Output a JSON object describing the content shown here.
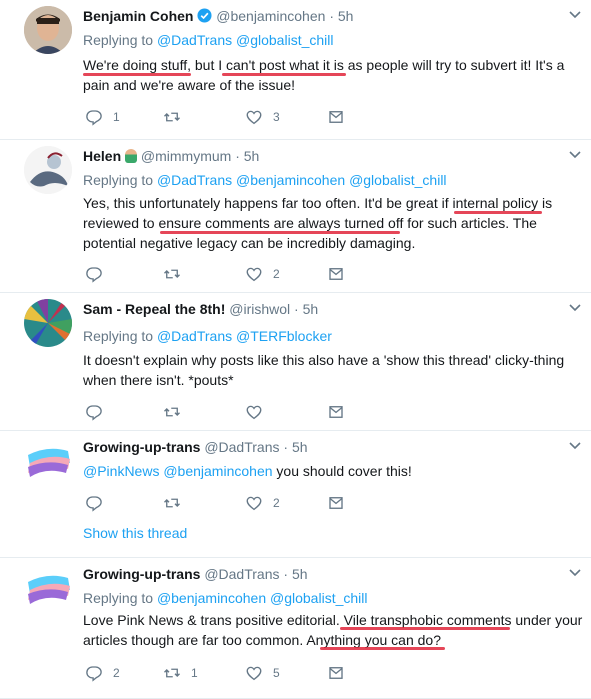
{
  "tweets": [
    {
      "name": "Benjamin Cohen",
      "handle": "@benjamincohen",
      "time": "· 5h",
      "replying_label": "Replying to",
      "replying_to": [
        "@DadTrans",
        "@globalist_chill"
      ],
      "lines": [
        "We're doing stuff, but I can't post what it is as people will try to subvert it! It's a",
        "pain and we're aware of the issue!"
      ],
      "counts": {
        "reply": "1",
        "retweet": "",
        "like": "3"
      }
    },
    {
      "name": "Helen",
      "handle": "@mimmymum",
      "time": "· 5h",
      "replying_label": "Replying to",
      "replying_to": [
        "@DadTrans",
        "@benjamincohen",
        "@globalist_chill"
      ],
      "lines": [
        "Yes, this unfortunately happens far too often. It'd be great if internal policy is",
        "reviewed to ensure comments are always turned off for such articles. The",
        "potential negative legacy can be incredibly damaging."
      ],
      "counts": {
        "reply": "",
        "retweet": "",
        "like": "2"
      }
    },
    {
      "name": "Sam - Repeal the 8th!",
      "handle": "@irishwol",
      "time": "· 5h",
      "replying_label": "Replying to",
      "replying_to": [
        "@DadTrans",
        "@TERFblocker"
      ],
      "lines": [
        "It doesn't explain why posts like this also have a 'show this thread' clicky-thing",
        "when there isn't. *pouts*"
      ],
      "counts": {
        "reply": "",
        "retweet": "",
        "like": ""
      }
    },
    {
      "name": "Growing-up-trans",
      "handle": "@DadTrans",
      "time": "· 5h",
      "mentions": [
        "@PinkNews",
        "@benjamincohen"
      ],
      "text_after": " you should cover this!",
      "counts": {
        "reply": "",
        "retweet": "",
        "like": "2"
      },
      "show_thread": "Show this thread"
    },
    {
      "name": "Growing-up-trans",
      "handle": "@DadTrans",
      "time": "· 5h",
      "replying_label": "Replying to",
      "replying_to": [
        "@benjamincohen",
        "@globalist_chill"
      ],
      "lines": [
        "Love Pink News & trans positive editorial. Vile transphobic comments  under your",
        "articles though are far too common. Anything you can do?"
      ],
      "counts": {
        "reply": "2",
        "retweet": "1",
        "like": "5"
      }
    }
  ],
  "colors": {
    "link": "#1da1f2",
    "muted": "#657786",
    "underline": "#e0263b"
  },
  "icons": [
    "chevron-down-icon",
    "reply-icon",
    "retweet-icon",
    "like-icon",
    "message-icon",
    "verified-icon"
  ]
}
